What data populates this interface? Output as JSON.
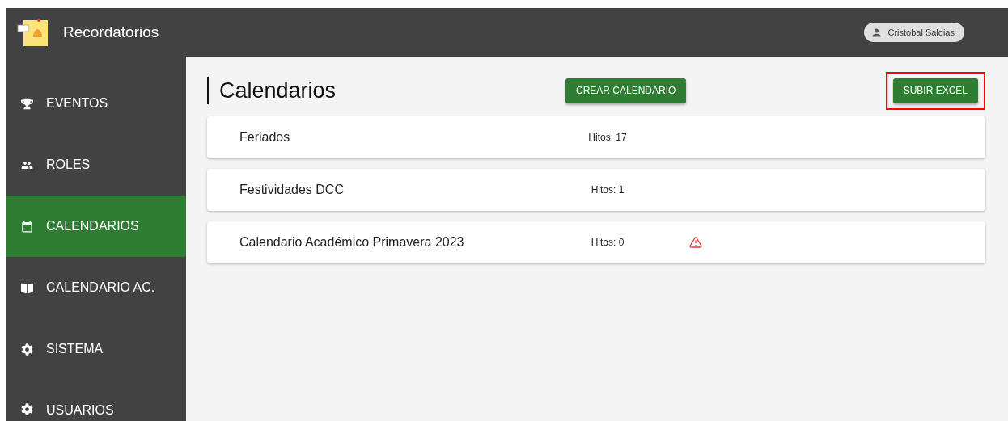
{
  "app": {
    "title": "Recordatorios"
  },
  "user": {
    "name": "Cristobal Saldias"
  },
  "sidebar": {
    "items": [
      {
        "label": "EVENTOS",
        "selected": false
      },
      {
        "label": "ROLES",
        "selected": false
      },
      {
        "label": "CALENDARIOS",
        "selected": true
      },
      {
        "label": "CALENDARIO AC.",
        "selected": false
      },
      {
        "label": "SISTEMA",
        "selected": false
      },
      {
        "label": "USUARIOS",
        "selected": false
      }
    ]
  },
  "page": {
    "title": "Calendarios",
    "buttons": [
      {
        "label": "CREAR CALENDARIO",
        "highlighted": false
      },
      {
        "label": "SUBIR EXCEL",
        "highlighted": true
      }
    ]
  },
  "calendars": [
    {
      "name": "Feriados",
      "hitos": "Hitos: 17",
      "warning": false
    },
    {
      "name": "Festividades DCC",
      "hitos": "Hitos: 1",
      "warning": false
    },
    {
      "name": "Calendario Académico Primavera 2023",
      "hitos": "Hitos: 0",
      "warning": true
    }
  ]
}
